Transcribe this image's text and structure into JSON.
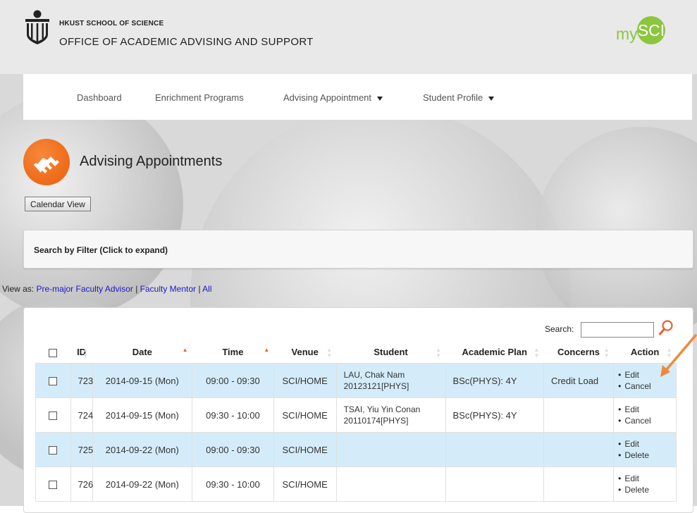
{
  "header": {
    "school": "HKUST SCHOOL OF SCIENCE",
    "office": "OFFICE OF ACADEMIC ADVISING AND SUPPORT",
    "brand_prefix": "my",
    "brand_badge": "SCI",
    "brand_color": "#8cc63f"
  },
  "nav": {
    "items": [
      {
        "label": "Dashboard"
      },
      {
        "label": "Enrichment Programs"
      },
      {
        "label": "Advising Appointment"
      },
      {
        "label": "Student Profile"
      }
    ]
  },
  "page": {
    "title": "Advising Appointments",
    "icon": "handshake-icon",
    "accent_color": "#ee6a18",
    "calendar_button": "Calendar View"
  },
  "filter": {
    "label": "Search by Filter (Click to expand)"
  },
  "view_as": {
    "prefix": "View as:",
    "links": [
      "Pre-major Faculty Advisor",
      "Faculty Mentor",
      "All"
    ],
    "separator": "|"
  },
  "table": {
    "search_label": "Search:",
    "search_value": "",
    "headers": [
      "ID",
      "Date",
      "Time",
      "Venue",
      "Student",
      "Academic Plan",
      "Concerns",
      "Action"
    ],
    "rows": [
      {
        "id": "723",
        "date": "2014-09-15 (Mon)",
        "time": "09:00 - 09:30",
        "venue": "SCI/HOME",
        "student_name": "LAU, Chak Nam",
        "student_id": "20123121[PHYS]",
        "plan": "BSc(PHYS): 4Y",
        "concerns": "Credit Load",
        "actions": [
          "Edit",
          "Cancel"
        ]
      },
      {
        "id": "724",
        "date": "2014-09-15 (Mon)",
        "time": "09:30 - 10:00",
        "venue": "SCI/HOME",
        "student_name": "TSAI, Yiu Yin Conan",
        "student_id": "20110174[PHYS]",
        "plan": "BSc(PHYS): 4Y",
        "concerns": "",
        "actions": [
          "Edit",
          "Cancel"
        ]
      },
      {
        "id": "725",
        "date": "2014-09-22 (Mon)",
        "time": "09:00 - 09:30",
        "venue": "SCI/HOME",
        "student_name": "",
        "student_id": "",
        "plan": "",
        "concerns": "",
        "actions": [
          "Edit",
          "Delete"
        ]
      },
      {
        "id": "726",
        "date": "2014-09-22 (Mon)",
        "time": "09:30 - 10:00",
        "venue": "SCI/HOME",
        "student_name": "",
        "student_id": "",
        "plan": "",
        "concerns": "",
        "actions": [
          "Edit",
          "Delete"
        ]
      }
    ]
  }
}
